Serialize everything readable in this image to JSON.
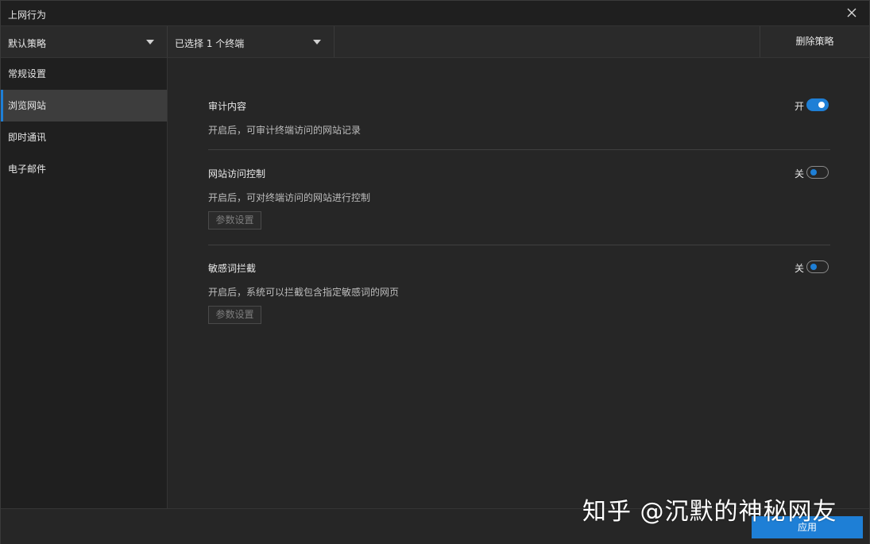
{
  "window": {
    "title": "上网行为"
  },
  "toolbar": {
    "policy_select": "默认策略",
    "terminal_select": "已选择 1 个终端",
    "delete_label": "删除策略"
  },
  "sidebar": {
    "items": [
      {
        "label": "常规设置",
        "active": false
      },
      {
        "label": "浏览网站",
        "active": true
      },
      {
        "label": "即时通讯",
        "active": false
      },
      {
        "label": "电子邮件",
        "active": false
      }
    ]
  },
  "sections": [
    {
      "title": "审计内容",
      "desc": "开启后，可审计终端访问的网站记录",
      "toggle_label": "开",
      "enabled": true
    },
    {
      "title": "网站访问控制",
      "desc": "开启后，可对终端访问的网站进行控制",
      "toggle_label": "关",
      "enabled": false,
      "param_label": "参数设置"
    },
    {
      "title": "敏感词拦截",
      "desc": "开启后，系统可以拦截包含指定敏感词的网页",
      "toggle_label": "关",
      "enabled": false,
      "param_label": "参数设置"
    }
  ],
  "footer": {
    "apply_label": "应用"
  },
  "watermark": "知乎 @沉默的神秘网友",
  "colors": {
    "accent": "#1e7fd6",
    "background": "#262626",
    "sidebar": "#1f1f1f"
  },
  "icons": {
    "close": "close-icon",
    "caret": "caret-down-icon"
  }
}
